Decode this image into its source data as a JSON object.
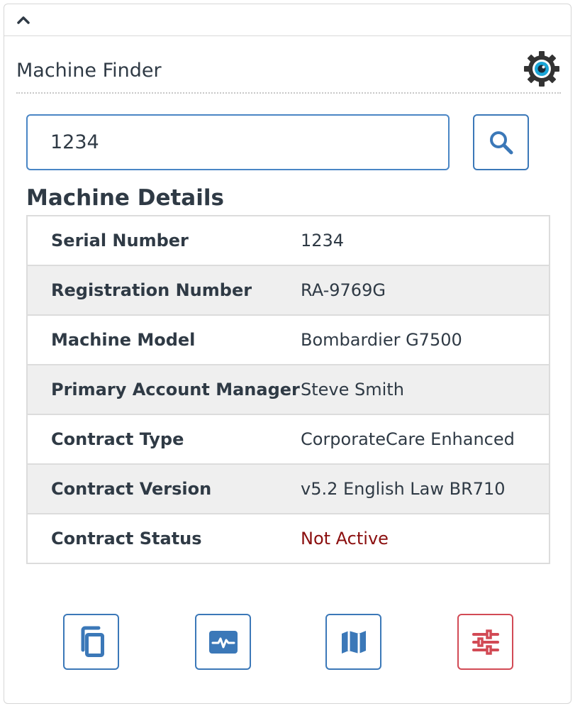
{
  "panel": {
    "collapse_icon": "chevron-up-icon",
    "title": "Machine Finder",
    "settings_icon": "gear-eye-icon"
  },
  "search": {
    "value": "1234",
    "button_icon": "search-icon"
  },
  "details": {
    "title": "Machine Details",
    "rows": [
      {
        "label": "Serial Number",
        "value": "1234"
      },
      {
        "label": "Registration Number",
        "value": "RA-9769G"
      },
      {
        "label": "Machine Model",
        "value": "Bombardier G7500"
      },
      {
        "label": "Primary Account Manager",
        "value": "Steve Smith"
      },
      {
        "label": "Contract Type",
        "value": "CorporateCare Enhanced"
      },
      {
        "label": "Contract Version",
        "value": "v5.2 English Law BR710"
      },
      {
        "label": "Contract Status",
        "value": "Not Active"
      }
    ]
  },
  "actions": [
    {
      "icon": "copy-icon"
    },
    {
      "icon": "activity-monitor-icon"
    },
    {
      "icon": "map-icon"
    },
    {
      "icon": "sliders-icon"
    }
  ],
  "colors": {
    "accent": "#3b78b8",
    "danger": "#d24a55",
    "status_inactive": "#8b0f0f",
    "gear_eye": "#1aa6d8"
  }
}
